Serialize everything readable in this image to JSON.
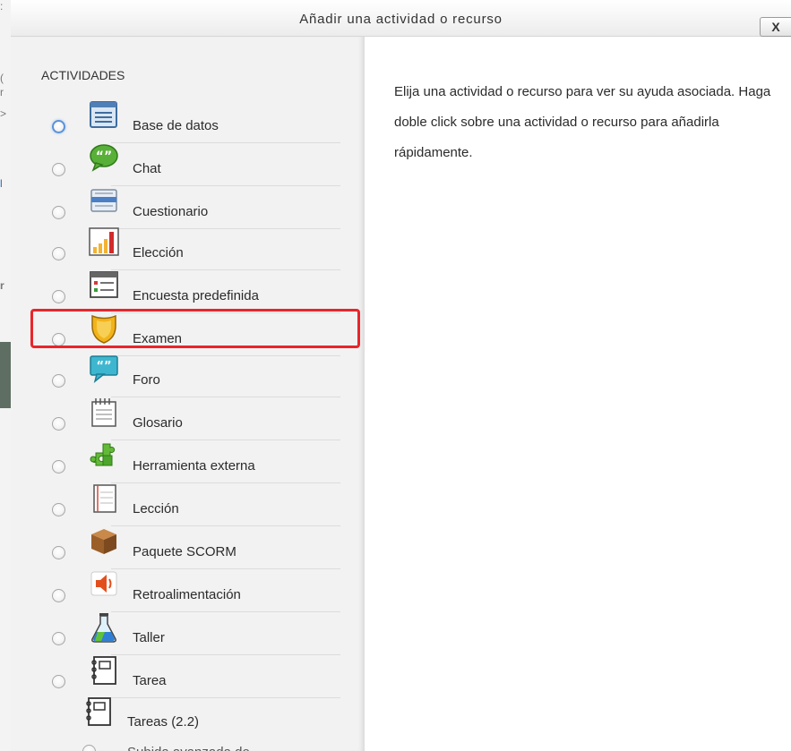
{
  "dialog": {
    "title": "Añadir una actividad o recurso",
    "close_label": "X",
    "section_title": "ACTIVIDADES",
    "help_text": "Elija una actividad o recurso para ver su ayuda asociada. Haga doble click sobre una actividad o recurso para añadirla rápidamente.",
    "activities": [
      {
        "label": "Base de datos",
        "icon": "database-icon",
        "focused": true
      },
      {
        "label": "Chat",
        "icon": "chat-icon"
      },
      {
        "label": "Cuestionario",
        "icon": "questionnaire-icon"
      },
      {
        "label": "Elección",
        "icon": "choice-chart-icon"
      },
      {
        "label": "Encuesta predefinida",
        "icon": "survey-icon"
      },
      {
        "label": "Examen",
        "icon": "quiz-shield-icon",
        "highlighted": true
      },
      {
        "label": "Foro",
        "icon": "forum-icon"
      },
      {
        "label": "Glosario",
        "icon": "glossary-icon"
      },
      {
        "label": "Herramienta externa",
        "icon": "puzzle-icon"
      },
      {
        "label": "Lección",
        "icon": "lesson-icon"
      },
      {
        "label": "Paquete SCORM",
        "icon": "package-box-icon"
      },
      {
        "label": "Retroalimentación",
        "icon": "feedback-speaker-icon"
      },
      {
        "label": "Taller",
        "icon": "workshop-flask-icon"
      },
      {
        "label": "Tarea",
        "icon": "assignment-icon"
      },
      {
        "label": "Tareas (2.2)",
        "icon": "assignment-icon"
      }
    ],
    "partial_next_label": "Subida avanzada de..."
  },
  "colors": {
    "highlight": "#e8262b",
    "focus_ring": "#5b92d8",
    "panel_bg": "#f2f2f2"
  }
}
